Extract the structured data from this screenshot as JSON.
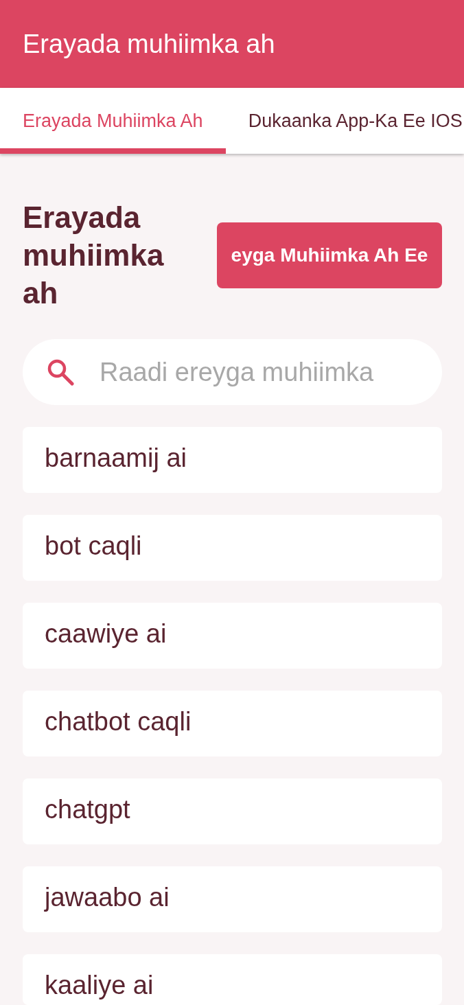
{
  "app_bar": {
    "title": "Erayada muhiimka ah"
  },
  "tabs": [
    {
      "label": "Erayada Muhiimka Ah",
      "selected": true
    },
    {
      "label": "Dukaanka App-Ka Ee IOS",
      "selected": false
    }
  ],
  "heading": "Erayada muhiimka ah",
  "action_button": {
    "label": "eyga Muhiimka Ah Ee"
  },
  "search": {
    "placeholder": "Raadi ereyga muhiimka"
  },
  "keywords": [
    "barnaamij ai",
    "bot caqli",
    "caawiye ai",
    "chatbot caqli",
    "chatgpt",
    "jawaabo ai",
    "kaaliye ai"
  ]
}
